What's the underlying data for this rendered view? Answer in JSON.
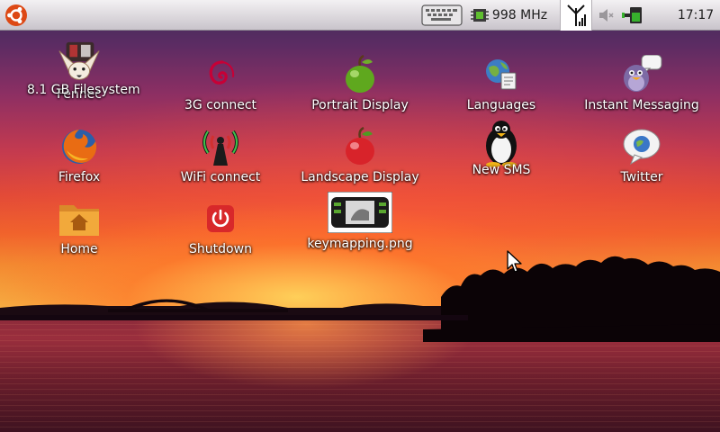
{
  "panel": {
    "ubuntu_icon": "ubuntu-logo-icon",
    "keyboard_icon": "keyboard-icon",
    "cpu_icon": "cpu-chip-icon",
    "cpu_frequency": "998",
    "cpu_unit": "MHz",
    "signal_icon": "signal-antenna-icon",
    "volume_icon": "volume-muted-icon",
    "battery_icon": "battery-icon",
    "clock": "17:17"
  },
  "desktop": {
    "filesystem_label": "8.1 GB Filesystem",
    "icons": [
      {
        "label": "Fennec",
        "icon": "fennec-icon"
      },
      {
        "label": "3G connect",
        "icon": "debian-swirl-icon"
      },
      {
        "label": "Portrait Display",
        "icon": "green-apple-icon"
      },
      {
        "label": "Languages",
        "icon": "languages-globe-icon"
      },
      {
        "label": "Instant Messaging",
        "icon": "pidgin-icon"
      },
      {
        "label": "Firefox",
        "icon": "firefox-icon"
      },
      {
        "label": "WiFi connect",
        "icon": "wifi-antenna-icon"
      },
      {
        "label": "Landscape Display",
        "icon": "red-apple-icon"
      },
      {
        "label": "New SMS",
        "icon": "tux-penguin-icon"
      },
      {
        "label": "Twitter",
        "icon": "twitter-bubble-icon"
      },
      {
        "label": "Home",
        "icon": "home-folder-icon"
      },
      {
        "label": "Shutdown",
        "icon": "power-icon"
      },
      {
        "label": "keymapping.png",
        "icon": "image-thumbnail-icon"
      }
    ]
  },
  "colors": {
    "panel_top": "#f3f1f3",
    "panel_bottom": "#c9c4cb",
    "ubuntu_orange": "#dd4814",
    "label_text": "#ffffff"
  }
}
